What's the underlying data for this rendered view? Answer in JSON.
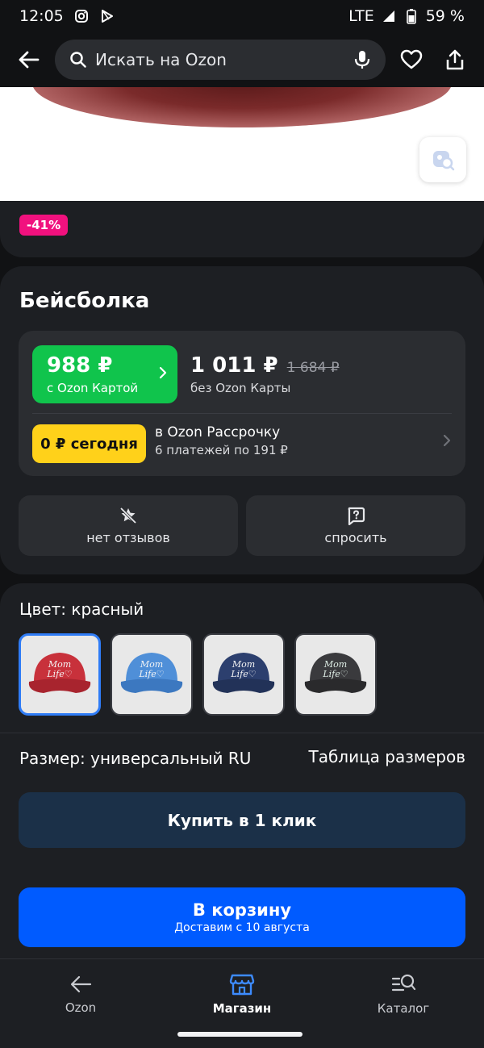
{
  "status_bar": {
    "time": "12:05",
    "network": "LTE",
    "battery": "59 %"
  },
  "top_bar": {
    "search_placeholder": "Искать на Ozon"
  },
  "product": {
    "discount": "-41%",
    "title": "Бейсболка",
    "price_card": "988 ₽",
    "price_card_label": "с Ozon Картой",
    "price_regular": "1 011 ₽",
    "price_old": "1 684 ₽",
    "price_regular_label": "без Ozon Карты",
    "installment_badge": "0 ₽ сегодня",
    "installment_title": "в Ozon Рассрочку",
    "installment_sub": "6 платежей по 191 ₽",
    "reviews_label": "нет отзывов",
    "ask_label": "спросить"
  },
  "variants": {
    "color_label": "Цвет: красный",
    "swatch_colors": [
      "#c8313b",
      "#4f8fd8",
      "#2c3f6e",
      "#3a3a3d"
    ],
    "selected_index": 0,
    "size_label": "Размер: универсальный RU",
    "size_table_label": "Таблица размеров",
    "buy_one_click": "Купить в 1 клик",
    "add_to_cart": "В корзину",
    "delivery": "Доставим с 10 августа"
  },
  "bottom_nav": {
    "items": [
      {
        "label": "Ozon",
        "icon": "back-arrow-icon"
      },
      {
        "label": "Магазин",
        "icon": "store-icon"
      },
      {
        "label": "Каталог",
        "icon": "catalog-search-icon"
      }
    ],
    "active_index": 1
  },
  "colors": {
    "accent_blue": "#005bff",
    "green_price": "#10c44c",
    "yellow_badge": "#ffd11a",
    "discount_pink": "#f1117e"
  }
}
